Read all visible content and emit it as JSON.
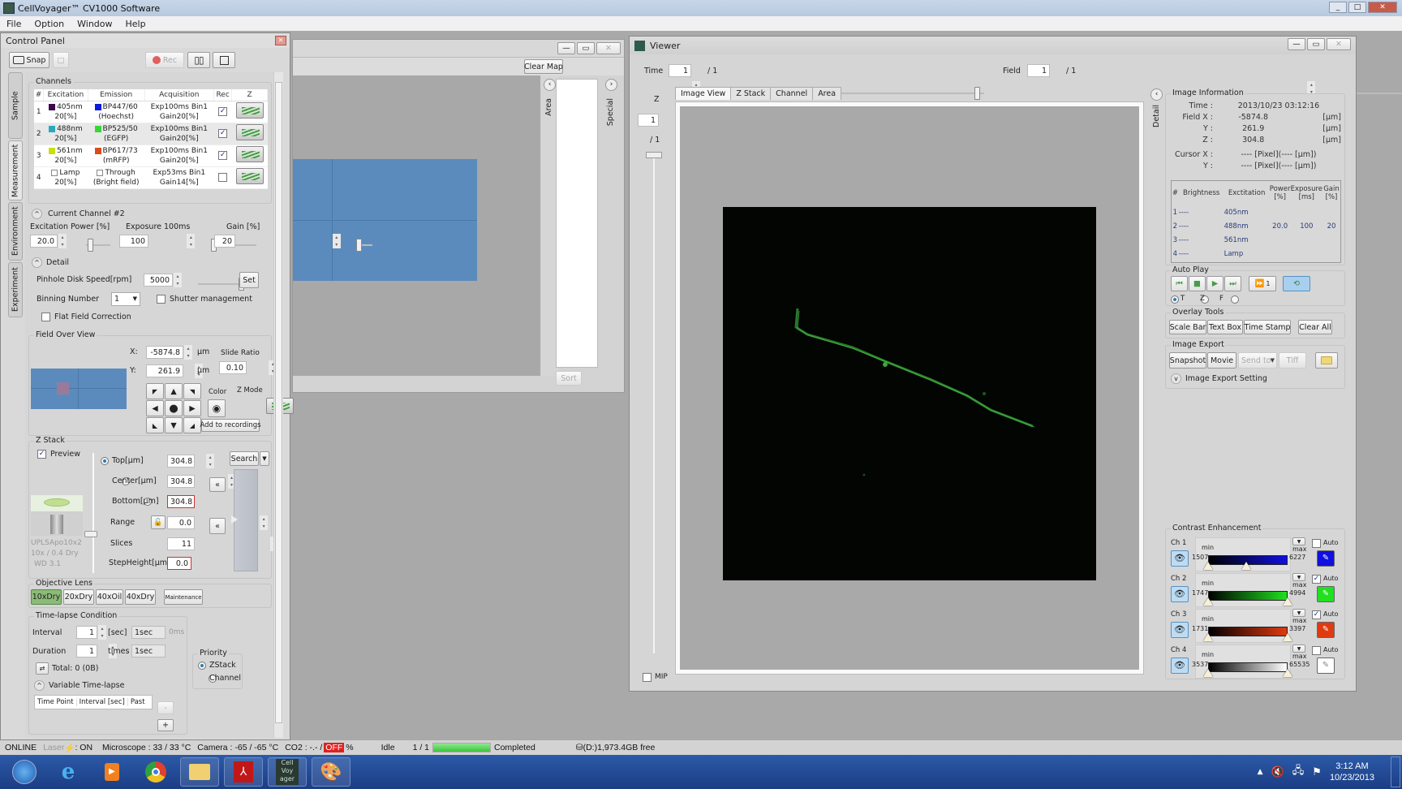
{
  "app": {
    "title": "CellVoyager™ CV1000 Software",
    "menu": [
      "File",
      "Option",
      "Window",
      "Help"
    ]
  },
  "control_panel": {
    "title": "Control Panel",
    "toolbar": {
      "snap": "Snap",
      "rec": "Rec"
    },
    "vertical_tabs": [
      "Sample",
      "Measurement",
      "Environment",
      "Experiment"
    ],
    "channels": {
      "label": "Channels",
      "headers": [
        "#",
        "Excitation",
        "Emission",
        "Acquisition",
        "Rec",
        "Z"
      ],
      "rows": [
        {
          "num": "1",
          "exc_color": "#3a0a4a",
          "exc": "405nm",
          "exc_pct": "20[%]",
          "em_color": "#0a1ae0",
          "em": "BP447/60",
          "em_dye": "(Hoechst)",
          "acq1": "Exp100ms Bin1",
          "acq2": "Gain20[%]",
          "rec": true
        },
        {
          "num": "2",
          "exc_color": "#2aa8c0",
          "exc": "488nm",
          "exc_pct": "20[%]",
          "em_color": "#36d636",
          "em": "BP525/50",
          "em_dye": "(EGFP)",
          "acq1": "Exp100ms Bin1",
          "acq2": "Gain20[%]",
          "rec": true
        },
        {
          "num": "3",
          "exc_color": "#c8e010",
          "exc": "561nm",
          "exc_pct": "20[%]",
          "em_color": "#e04a1a",
          "em": "BP617/73",
          "em_dye": "(mRFP)",
          "acq1": "Exp100ms Bin1",
          "acq2": "Gain20[%]",
          "rec": true
        },
        {
          "num": "4",
          "exc_color": "",
          "exc": "Lamp",
          "exc_pct": "20[%]",
          "em_color": "",
          "em": "Through",
          "em_dye": "(Bright field)",
          "acq1": "Exp53ms Bin1",
          "acq2": "Gain14[%]",
          "rec": false
        }
      ]
    },
    "current_channel": {
      "label": "Current Channel  #2",
      "excitation_label": "Excitation  Power [%]",
      "excitation_value": "20.0",
      "exposure_label": "Exposure  100ms",
      "exposure_value": "100",
      "gain_label": "Gain [%]",
      "gain_value": "20"
    },
    "detail": {
      "label": "Detail",
      "pinhole_label": "Pinhole Disk Speed[rpm]",
      "pinhole_value": "5000",
      "set_label": "Set",
      "binning_label": "Binning Number",
      "binning_value": "1",
      "shutter_label": "Shutter management",
      "flatfield_label": "Flat Field Correction"
    },
    "field_overview": {
      "label": "Field Over View",
      "x_label": "X:",
      "x_value": "-5874.8",
      "y_label": "Y:",
      "y_value": "261.9",
      "unit": "µm",
      "slide_ratio_label": "Slide Ratio",
      "slide_ratio_value": "0.10",
      "color_label": "Color",
      "zmode_label": "Z Mode",
      "add_label": "Add to recordings"
    },
    "zstack": {
      "label": "Z Stack",
      "preview_label": "Preview",
      "top_label": "Top[µm]",
      "top_value": "304.8",
      "center_label": "Center[µm]",
      "center_value": "304.8",
      "bottom_label": "Bottom[µm]",
      "bottom_value": "304.8",
      "range_label": "Range",
      "range_value": "0.0",
      "slices_label": "Slices",
      "slices_value": "11",
      "step_label": "StepHeight[µm]",
      "step_value": "0.0",
      "search_label": "Search",
      "lens_name": "UPLSApo10x2",
      "lens_spec": "10x / 0.4 Dry",
      "lens_wd": "WD 3.1"
    },
    "objective": {
      "label": "Objective Lens",
      "lenses": [
        "10xDry",
        "20xDry",
        "40xOil",
        "40xDry"
      ],
      "active": "10xDry",
      "maintenance": "Maintenance"
    },
    "timelapse": {
      "label": "Time-lapse Condition",
      "interval_label": "Interval",
      "interval_value": "1",
      "interval_unit": "[sec]",
      "interval_text": "1sec",
      "interval_ms": "0ms",
      "duration_label": "Duration",
      "duration_value": "1",
      "duration_unit": "times",
      "duration_text": "1sec",
      "total": "Total:  0 (0B)",
      "variable_label": "Variable Time-lapse",
      "var_headers": [
        "Time Point",
        "Interval [sec]",
        "Past"
      ],
      "minus": "-",
      "plus": "+"
    },
    "priority": {
      "label": "Priority",
      "options": [
        "ZStack",
        "Channel"
      ],
      "selected": "ZStack"
    }
  },
  "map_window": {
    "clear_map": "Clear Map",
    "area_label": "Area",
    "special_label": "Special",
    "sort_label": "Sort"
  },
  "viewer": {
    "title": "Viewer",
    "time_label": "Time",
    "time_value": "1",
    "time_total": "/ 1",
    "field_label": "Field",
    "field_value": "1",
    "field_total": "/ 1",
    "z_label": "Z",
    "z_value": "1",
    "z_total": "/ 1",
    "tabs": [
      "Image View",
      "Z Stack",
      "Channel",
      "Area"
    ],
    "active_tab": "Image View",
    "mip_label": "MIP",
    "detail_label": "Detail",
    "image_info": {
      "label": "Image Information",
      "time_label": "Time :",
      "time_value": "2013/10/23 03:12:16",
      "fieldx_label": "Field X :",
      "fieldx_value": "-5874.8",
      "y_label": "Y :",
      "y_value": "261.9",
      "z_label": "Z :",
      "z_value": "304.8",
      "unit": "[µm]",
      "cursorx_label": "Cursor X :",
      "cursorx_value": "---- [Pixel](---- [µm])",
      "cursory_label": "Y :",
      "cursory_value": "---- [Pixel](---- [µm])",
      "table_headers": [
        "#",
        "Brightness",
        "Exctitation",
        "Power [%]",
        "Exposure [ms]",
        "Gain [%]"
      ],
      "rows": [
        {
          "n": "1",
          "b": "----",
          "e": "405nm",
          "p": "",
          "x": "",
          "g": ""
        },
        {
          "n": "2",
          "b": "----",
          "e": "488nm",
          "p": "20.0",
          "x": "100",
          "g": "20"
        },
        {
          "n": "3",
          "b": "----",
          "e": "561nm",
          "p": "",
          "x": "",
          "g": ""
        },
        {
          "n": "4",
          "b": "----",
          "e": "Lamp",
          "p": "",
          "x": "",
          "g": ""
        }
      ]
    },
    "auto_play": {
      "label": "Auto Play",
      "step": "1",
      "modes": [
        "T",
        "Z",
        "F"
      ],
      "selected": "T"
    },
    "overlay": {
      "label": "Overlay Tools",
      "buttons": [
        "Scale Bar",
        "Text Box",
        "Time Stamp",
        "Clear All"
      ]
    },
    "export": {
      "label": "Image Export",
      "snapshot": "Snapshot",
      "movie": "Movie",
      "send_to": "Send to",
      "tiff": "Tiff",
      "setting": "Image Export Setting"
    },
    "contrast": {
      "label": "Contrast Enhancement",
      "channels": [
        {
          "name": "Ch 1",
          "min": "1507",
          "max": "6227",
          "auto": false,
          "color": "#1010e0",
          "min_pos": 0.0,
          "max_pos": 0.48
        },
        {
          "name": "Ch 2",
          "min": "1747",
          "max": "4994",
          "auto": true,
          "color": "#20e020",
          "min_pos": 0.0,
          "max_pos": 1.0
        },
        {
          "name": "Ch 3",
          "min": "1731",
          "max": "3397",
          "auto": true,
          "color": "#e03a10",
          "min_pos": 0.0,
          "max_pos": 1.0
        },
        {
          "name": "Ch 4",
          "min": "3537",
          "max": "65535",
          "auto": false,
          "color": "#ffffff",
          "min_pos": 0.0,
          "max_pos": 1.0
        }
      ],
      "min_label": "min",
      "max_label": "max",
      "auto_label": "Auto"
    }
  },
  "status_bar": {
    "online": "ONLINE",
    "laser": "Laser",
    "laser_state": ": ON",
    "microscope": "Microscope : 33 / 33 °C",
    "camera": "Camera : -65 / -65 °C",
    "co2": "CO2 : -.- /",
    "off": "OFF",
    "pct": "%",
    "idle": "Idle",
    "progress_text": "1 / 1",
    "progress": 1.0,
    "completed": "Completed",
    "disk": "(D:)1,973.4GB free"
  },
  "taskbar": {
    "apps": [
      "start",
      "internet-explorer",
      "media-player",
      "chrome",
      "file-explorer",
      "acrobat",
      "cellvoyager",
      "paint"
    ],
    "time": "3:12 AM",
    "date": "10/23/2013"
  }
}
